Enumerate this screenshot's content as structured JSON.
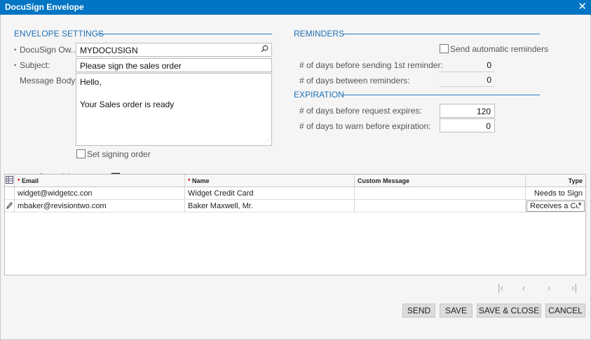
{
  "window": {
    "title": "DocuSign Envelope",
    "close_icon": "close-icon"
  },
  "envelope_settings": {
    "section_title": "ENVELOPE SETTINGS",
    "docusign_owner_label": "DocuSign Ow...",
    "docusign_owner_value": "MYDOCUSIGN",
    "subject_label": "Subject:",
    "subject_value": "Please sign the sales order",
    "message_body_label": "Message Body:",
    "message_body_lines": [
      "Hello,",
      "",
      "Your Sales order is ready"
    ],
    "set_signing_order_label": "Set signing order",
    "set_signing_order_checked": false
  },
  "reminders": {
    "section_title": "REMINDERS",
    "send_automatic_label": "Send automatic reminders",
    "send_automatic_checked": false,
    "first_reminder_label": "# of days before sending 1st reminder:",
    "first_reminder_value": "0",
    "between_label": "# of days between reminders:",
    "between_value": "0"
  },
  "expiration": {
    "section_title": "EXPIRATION",
    "expires_label": "# of days before request expires:",
    "expires_value": "120",
    "warn_label": "# of days to warn before expiration:",
    "warn_value": "0"
  },
  "toolbar": {
    "icons": [
      "refresh-icon",
      "add-icon",
      "delete-icon",
      "fit-columns-icon",
      "export-icon"
    ]
  },
  "grid": {
    "columns": {
      "email": "Email",
      "name": "Name",
      "custom_message": "Custom Message",
      "type": "Type"
    },
    "rows": [
      {
        "email": "widget@widgetcc.con",
        "name": "Widget Credit Card",
        "custom_message": "",
        "type": "Needs to Sign"
      },
      {
        "email": "mbaker@revisiontwo.com",
        "name": "Baker Maxwell, Mr.",
        "custom_message": "",
        "type": "Receives a Co"
      }
    ]
  },
  "pager": {
    "icons": [
      "first-page-icon",
      "previous-page-icon",
      "next-page-icon",
      "last-page-icon"
    ]
  },
  "buttons": {
    "send": "SEND",
    "save": "SAVE",
    "save_close": "SAVE & CLOSE",
    "cancel": "CANCEL"
  },
  "colors": {
    "accent": "#0075c4",
    "section": "#1f6fb5",
    "required": "#d00000"
  }
}
